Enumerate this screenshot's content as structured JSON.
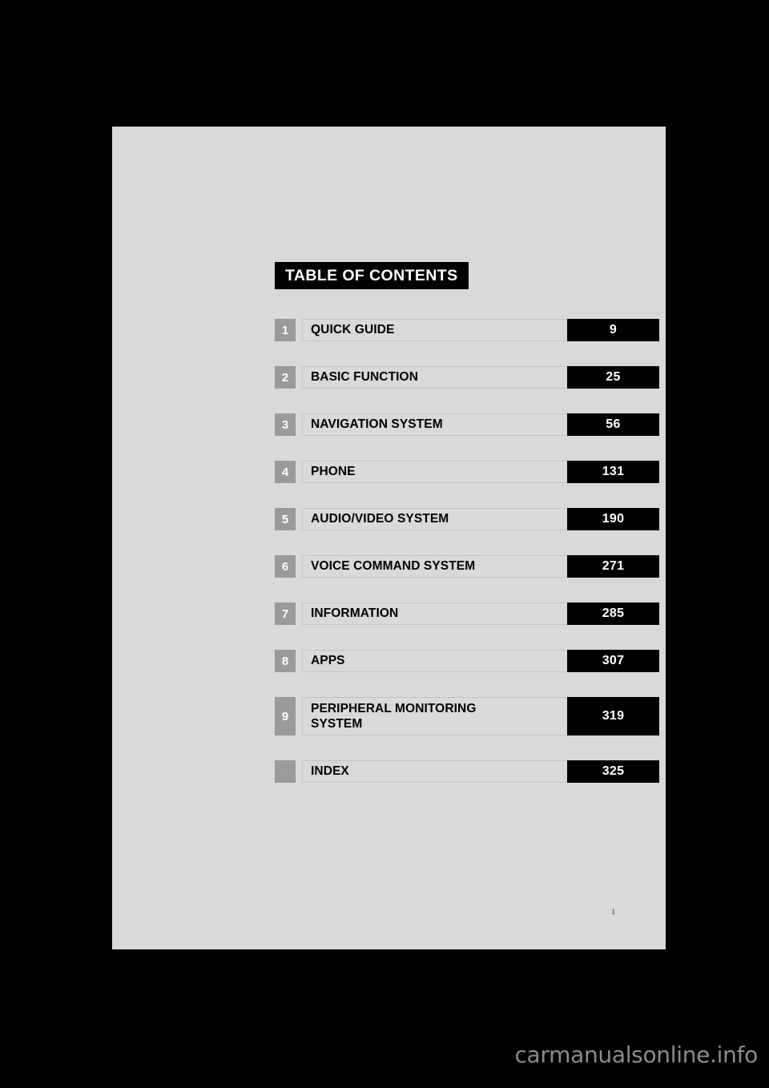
{
  "document": {
    "background_color": "#000000",
    "page_color": "#d9d9d9",
    "banner_title": "TABLE OF CONTENTS",
    "folio": "1"
  },
  "toc": {
    "rows": [
      {
        "number": "1",
        "label": "QUICK GUIDE",
        "label_line2": "",
        "page": "9",
        "tall": false
      },
      {
        "number": "2",
        "label": "BASIC FUNCTION",
        "label_line2": "",
        "page": "25",
        "tall": false
      },
      {
        "number": "3",
        "label": "NAVIGATION SYSTEM",
        "label_line2": "",
        "page": "56",
        "tall": false
      },
      {
        "number": "4",
        "label": "PHONE",
        "label_line2": "",
        "page": "131",
        "tall": false
      },
      {
        "number": "5",
        "label": "AUDIO/VIDEO SYSTEM",
        "label_line2": "",
        "page": "190",
        "tall": false
      },
      {
        "number": "6",
        "label": "VOICE COMMAND SYSTEM",
        "label_line2": "",
        "page": "271",
        "tall": false
      },
      {
        "number": "7",
        "label": "INFORMATION",
        "label_line2": "",
        "page": "285",
        "tall": false
      },
      {
        "number": "8",
        "label": "APPS",
        "label_line2": "",
        "page": "307",
        "tall": false
      },
      {
        "number": "9",
        "label": "PERIPHERAL MONITORING",
        "label_line2": "SYSTEM",
        "page": "319",
        "tall": true
      },
      {
        "number": "",
        "label": "INDEX",
        "label_line2": "",
        "page": "325",
        "tall": false
      }
    ]
  },
  "watermark": {
    "name": "carmanualsonline",
    "tld": ".info"
  },
  "colors": {
    "page_background": "#d9d9d9",
    "badge_gray": "#9a9a9a",
    "box_black": "#000000",
    "label_border": "#c3c3c3",
    "watermark_gray": "#8c8c8c"
  }
}
